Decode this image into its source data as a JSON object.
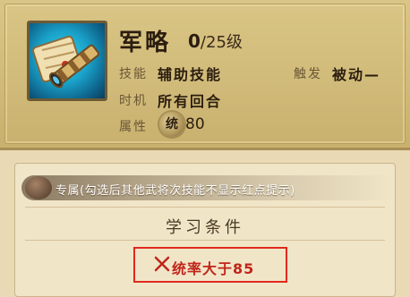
{
  "skill": {
    "name": "军略",
    "level_current": "0",
    "level_max": "/25级",
    "icon": "scroll-and-spyglass-icon",
    "type_label": "技能",
    "type_value": "辅助技能",
    "trigger_label": "触发",
    "trigger_value": "被动—",
    "timing_label": "时机",
    "timing_value": "所有回合",
    "attribute_label": "属性",
    "attribute_badge": "统",
    "attribute_value": "80"
  },
  "exclusive": {
    "text": "专属(勾选后其他武将次技能不显示红点提示)"
  },
  "learn": {
    "title": "学习条件",
    "condition": "统率大于85",
    "condition_status": "not-met"
  },
  "colors": {
    "card_bg": "#d5c07f",
    "panel_bg": "#f1e5c8",
    "condition_red": "#e0281e"
  }
}
